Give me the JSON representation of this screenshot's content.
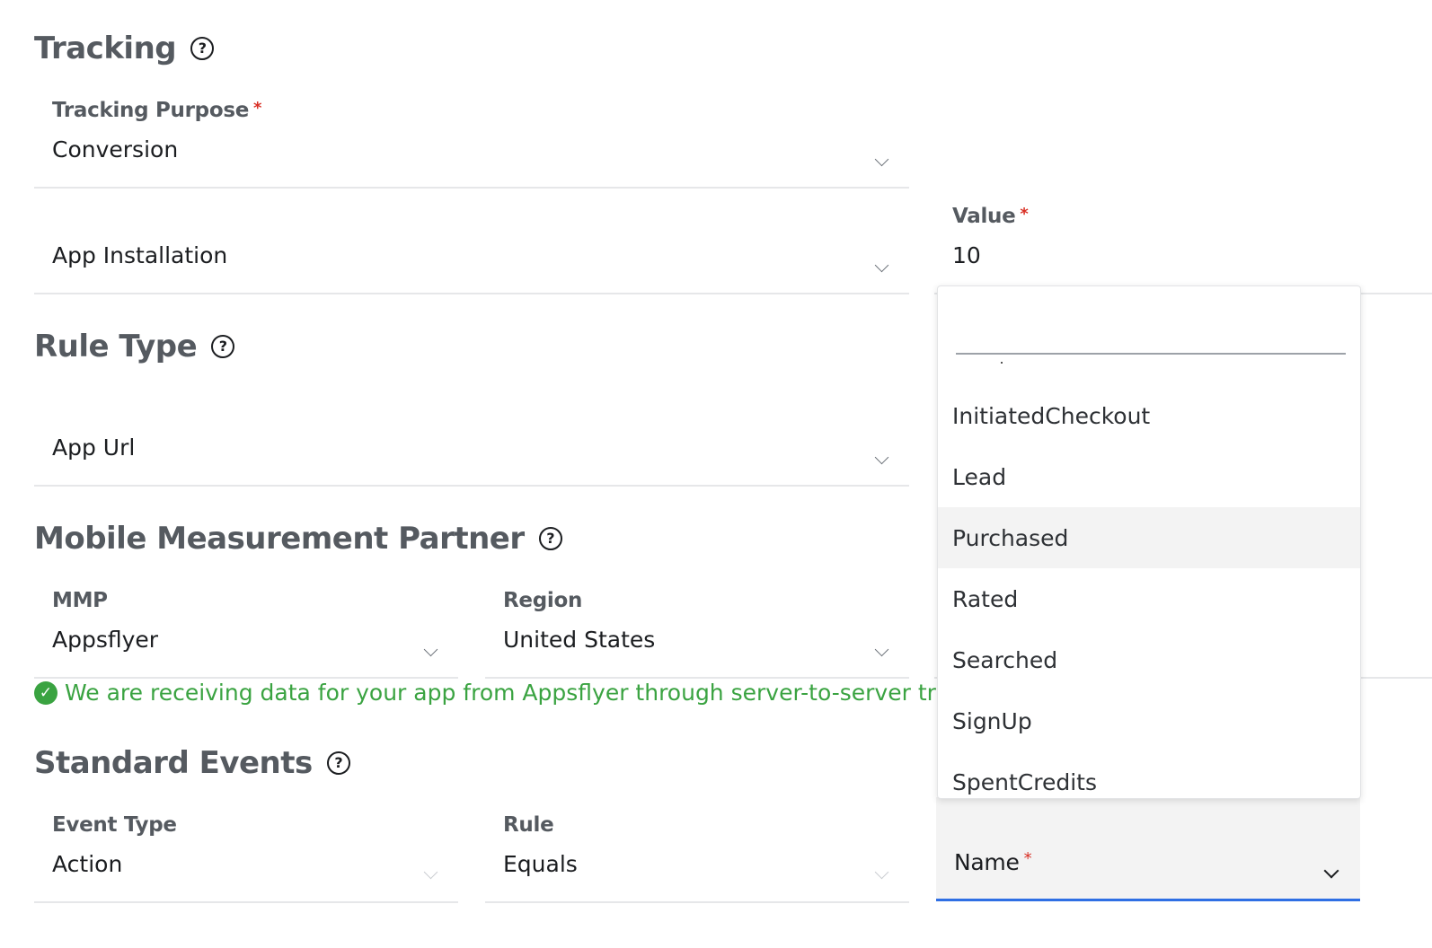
{
  "sections": {
    "tracking": "Tracking",
    "rule_type": "Rule Type",
    "mmp": "Mobile Measurement Partner",
    "standard_events": "Standard Events"
  },
  "icons": {
    "help": "question-circle-icon",
    "chevron": "chevron-down-icon",
    "success": "check-circle-icon"
  },
  "fields": {
    "tracking_purpose": {
      "label": "Tracking Purpose",
      "required": "*",
      "value": "Conversion"
    },
    "conversion_event": {
      "value": "App Installation"
    },
    "value": {
      "label": "Value",
      "required": "*",
      "value": "10"
    },
    "rule_type": {
      "value": "App Url"
    },
    "mmp": {
      "label": "MMP",
      "value": "Appsflyer"
    },
    "region": {
      "label": "Region",
      "value": "United States"
    },
    "event_type": {
      "label": "Event Type",
      "value": "Action"
    },
    "rule": {
      "label": "Rule",
      "value": "Equals"
    },
    "name": {
      "label": "Name",
      "required": "*"
    }
  },
  "success_message": "We are receiving data for your app from Appsflyer through server-to-server tracking",
  "dropdown": {
    "search_placeholder": "",
    "options": [
      "InitiatedCheckout",
      "Lead",
      "Purchased",
      "Rated",
      "Searched",
      "SignUp",
      "SpentCredits"
    ],
    "hovered": "Purchased"
  },
  "colors": {
    "success": "#3aa341",
    "required": "#d93025",
    "focus_underline": "#2f6fe4",
    "title": "#555a60"
  }
}
